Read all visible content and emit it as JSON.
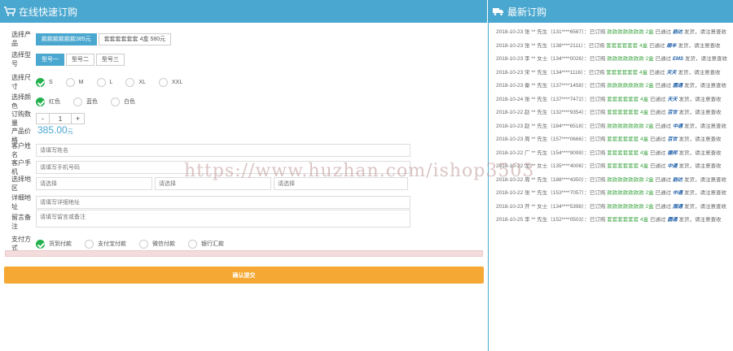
{
  "left_panel": {
    "title": "在线快速订购",
    "product": {
      "label": "选择产品",
      "options": [
        "款款款款款款385元",
        "套套套套套套 4盒 580元"
      ]
    },
    "model": {
      "label": "选择型号",
      "options": [
        "型号一",
        "型号二",
        "型号三"
      ]
    },
    "size": {
      "label": "选择尺寸",
      "options": [
        "S",
        "M",
        "L",
        "XL",
        "XXL"
      ]
    },
    "color": {
      "label": "选择颜色",
      "options": [
        "红色",
        "蓝色",
        "白色"
      ]
    },
    "quantity": {
      "label": "订购数量",
      "minus": "-",
      "value": "1",
      "plus": "+"
    },
    "price": {
      "label": "产品价格",
      "value": "385.00",
      "unit": "元"
    },
    "name": {
      "label": "客户姓名",
      "placeholder": "请填写姓名"
    },
    "phone": {
      "label": "客户手机",
      "placeholder": "请填写手机号码"
    },
    "region": {
      "label": "选择地区",
      "province": "请选择",
      "city": "请选择",
      "district": "请选择"
    },
    "address": {
      "label": "详细地址",
      "placeholder": "请填写详细地址"
    },
    "remark": {
      "label": "留言备注",
      "placeholder": "请填写留言或备注"
    },
    "payment": {
      "label": "支付方式",
      "options": [
        "货到付款",
        "支付宝付款",
        "微信付款",
        "银行汇款"
      ]
    },
    "progress": 0.0,
    "submit_label": "确认提交"
  },
  "right_panel": {
    "title": "最新订购",
    "orders": [
      {
        "text": "2018-10-23 张 ** 先生（131****6587）：已订购",
        "product": "款款款款款款款 2盒",
        "status": "已通过",
        "logo": "韵达",
        "tail": "发货，请注意查收"
      },
      {
        "text": "2018-10-23 张 ** 先生（138****2111）：已订购",
        "product": "套套套套套套 4盒",
        "status": "已通过",
        "logo": "顺丰",
        "tail": "发货，请注意查收"
      },
      {
        "text": "2018-10-23 李 ** 女士（134****0026）：已订购",
        "product": "款款款款款款款 2盒",
        "status": "已通过",
        "logo": "EMS",
        "tail": "发货，请注意查收"
      },
      {
        "text": "2018-10-23 宋 ** 先生（134****1116）：已订购",
        "product": "套套套套套套 4盒",
        "status": "已通过",
        "logo": "天天",
        "tail": "发货，请注意查收"
      },
      {
        "text": "2018-10-23 秦 ** 先生（137****1458）：已订购",
        "product": "款款款款款款款 2盒",
        "status": "已通过",
        "logo": "圆通",
        "tail": "发货，请注意查收"
      },
      {
        "text": "2018-10-24 张 ** 先生（137****7472）：已订购",
        "product": "套套套套套套 4盒",
        "status": "已通过",
        "logo": "天天",
        "tail": "发货，请注意查收"
      },
      {
        "text": "2018-10-22 赵 ** 先生（132****9354）：已订购",
        "product": "套套套套套套 4盒",
        "status": "已通过",
        "logo": "百世",
        "tail": "发货，请注意查收"
      },
      {
        "text": "2018-10-23 赵 ** 先生（184****6518）：已订购",
        "product": "款款款款款款款 2盒",
        "status": "已通过",
        "logo": "中通",
        "tail": "发货，请注意查收"
      },
      {
        "text": "2018-10-23 周 ** 先生（157****0666）：已订购",
        "product": "套套套套套套 4盒",
        "status": "已通过",
        "logo": "百世",
        "tail": "发货，请注意查收"
      },
      {
        "text": "2018-10-22 广 ** 先生（154****9099）：已订购",
        "product": "套套套套套套 4盒",
        "status": "已通过",
        "logo": "德邦",
        "tail": "发货，请注意查收"
      },
      {
        "text": "2018-10-22 龙 ** 女士（135****4006）：已订购",
        "product": "套套套套套套 4盒",
        "status": "已通过",
        "logo": "中通",
        "tail": "发货，请注意查收"
      },
      {
        "text": "2018-10-22 周 ** 先生（188****4350）：已订购",
        "product": "款款款款款款款 2盒",
        "status": "已通过",
        "logo": "韵达",
        "tail": "发货，请注意查收"
      },
      {
        "text": "2018-10-22 张 ** 先生（153****7057）：已订购",
        "product": "款款款款款款款 2盒",
        "status": "已通过",
        "logo": "中通",
        "tail": "发货，请注意查收"
      },
      {
        "text": "2018-10-23 开 ** 女士（134****5398）：已订购",
        "product": "款款款款款款款 2盒",
        "status": "已通过",
        "logo": "国通",
        "tail": "发货，请注意查收"
      },
      {
        "text": "2018-10-25 李 ** 先生（152****0503）：已订购",
        "product": "套套套套套套 4盒",
        "status": "已通过",
        "logo": "圆通",
        "tail": "发货，请注意查收"
      }
    ]
  },
  "watermark": "https://www.huzhan.com/ishop3503"
}
